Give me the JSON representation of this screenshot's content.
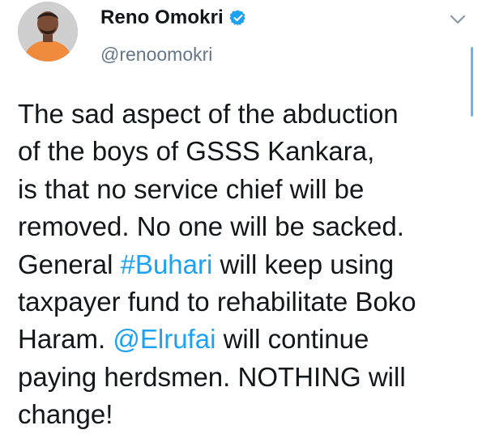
{
  "author": {
    "display_name": "Reno Omokri",
    "handle": "@renoomokri",
    "verified": true
  },
  "tweet": {
    "lines": [
      [
        {
          "t": "The sad aspect of the abduction"
        }
      ],
      [
        {
          "t": "of the boys of GSSS Kankara,"
        }
      ],
      [
        {
          "t": "is that no service chief will be"
        }
      ],
      [
        {
          "t": "removed. No one will be sacked."
        }
      ],
      [
        {
          "t": "General "
        },
        {
          "t": "#Buhari",
          "link": "hashtag"
        },
        {
          "t": " will keep using"
        }
      ],
      [
        {
          "t": "taxpayer fund to rehabilitate Boko"
        }
      ],
      [
        {
          "t": "Haram. "
        },
        {
          "t": "@Elrufai",
          "link": "mention"
        },
        {
          "t": " will continue"
        }
      ],
      [
        {
          "t": "paying herdsmen. NOTHING will"
        }
      ],
      [
        {
          "t": "change!"
        }
      ]
    ]
  },
  "icons": {
    "verified": "verified-badge-icon",
    "caret": "chevron-down-icon"
  },
  "colors": {
    "link": "#1da1f2",
    "verified": "#1da1f2",
    "handle": "#657786",
    "text": "#14171a"
  }
}
